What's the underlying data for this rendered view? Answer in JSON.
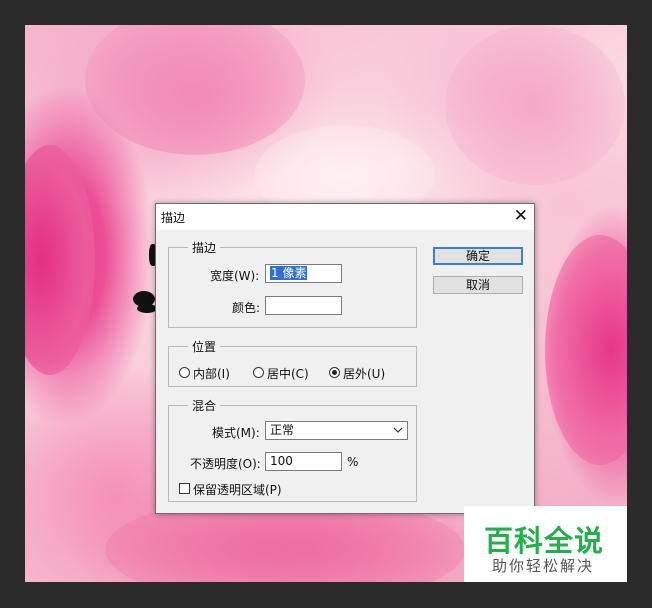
{
  "dialog": {
    "title": "描边",
    "close_symbol": "✕",
    "stroke_group": {
      "legend": "描边",
      "width_label": "宽度(W):",
      "width_value": "1 像素",
      "color_label": "颜色:"
    },
    "position_group": {
      "legend": "位置",
      "options": [
        {
          "label": "内部(I)",
          "selected": false
        },
        {
          "label": "居中(C)",
          "selected": false
        },
        {
          "label": "居外(U)",
          "selected": true
        }
      ]
    },
    "blend_group": {
      "legend": "混合",
      "mode_label": "模式(M):",
      "mode_value": "正常",
      "opacity_label": "不透明度(O):",
      "opacity_value": "100",
      "opacity_unit": "%",
      "preserve_label": "保留透明区域(P)",
      "preserve_checked": false
    },
    "buttons": {
      "ok": "确定",
      "cancel": "取消"
    }
  },
  "watermark": {
    "main": "百科全说",
    "sub": "助你轻松解决"
  },
  "colors": {
    "accent": "#2f6fd6",
    "watermark_green": "#21b04b",
    "dialog_bg": "#f0f0f0"
  }
}
